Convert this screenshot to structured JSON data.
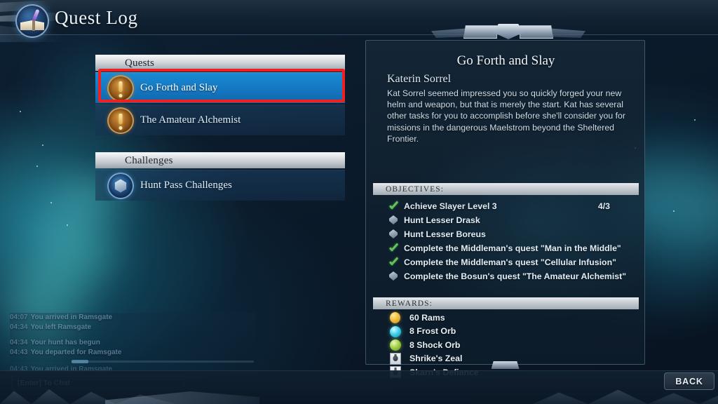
{
  "window": {
    "title": "Quest Log",
    "title_icon": "quest-book-icon"
  },
  "quest_list": {
    "sections": [
      {
        "header": "Quests",
        "items": [
          {
            "label": "Go Forth and Slay",
            "icon": "quest-exclamation-icon",
            "selected": true
          },
          {
            "label": "The Amateur Alchemist",
            "icon": "quest-exclamation-icon",
            "selected": false
          }
        ]
      },
      {
        "header": "Challenges",
        "items": [
          {
            "label": "Hunt Pass Challenges",
            "icon": "hunt-pass-gem-icon",
            "selected": false
          }
        ]
      }
    ]
  },
  "detail": {
    "title": "Go Forth and Slay",
    "giver": "Katerin Sorrel",
    "description": "Kat Sorrel seemed impressed you so quickly forged your new helm and weapon, but that is merely the start. Kat has several other tasks for you to accomplish before she'll consider you for missions in the dangerous Maelstrom beyond the Sheltered Frontier.",
    "objectives_header": "OBJECTIVES:",
    "objectives": [
      {
        "text": "Achieve Slayer Level 3",
        "state": "complete",
        "count": "4/3"
      },
      {
        "text": "Hunt Lesser Drask",
        "state": "incomplete",
        "count": ""
      },
      {
        "text": "Hunt Lesser Boreus",
        "state": "incomplete",
        "count": ""
      },
      {
        "text": "Complete the Middleman's quest \"Man in the Middle\"",
        "state": "complete",
        "count": ""
      },
      {
        "text": "Complete the Middleman's quest \"Cellular Infusion\"",
        "state": "complete",
        "count": ""
      },
      {
        "text": "Complete the Bosun's quest \"The Amateur Alchemist\"",
        "state": "incomplete",
        "count": ""
      }
    ],
    "rewards_header": "REWARDS:",
    "rewards": [
      {
        "text": "60 Rams",
        "icon": "rams-coin-icon"
      },
      {
        "text": "8 Frost Orb",
        "icon": "frost-orb-icon"
      },
      {
        "text": "8 Shock Orb",
        "icon": "shock-orb-icon"
      },
      {
        "text": "Shrike's Zeal",
        "icon": "cell-card-icon"
      },
      {
        "text": "Skarn's Defiance",
        "icon": "cell-card-icon"
      }
    ]
  },
  "chat": {
    "lines": [
      {
        "time": "04:07",
        "message": "You arrived in Ramsgate",
        "dim": false
      },
      {
        "time": "04:34",
        "message": "You left Ramsgate",
        "dim": false
      },
      {
        "time": "04:34",
        "message": "Your hunt has begun",
        "dim": false
      },
      {
        "time": "04:43",
        "message": "You departed for Ramsgate",
        "dim": false
      },
      {
        "time": "04:43",
        "message": "You arrived in Ramsgate",
        "dim": true
      }
    ],
    "input_hint": "[Enter] To Chat"
  },
  "footer": {
    "back_label": "BACK"
  },
  "colors": {
    "selection_highlight": "#ee2020",
    "selected_row": "#1578c2",
    "objective_complete": "#63c45c",
    "accent_blue": "#1a8ad4"
  }
}
